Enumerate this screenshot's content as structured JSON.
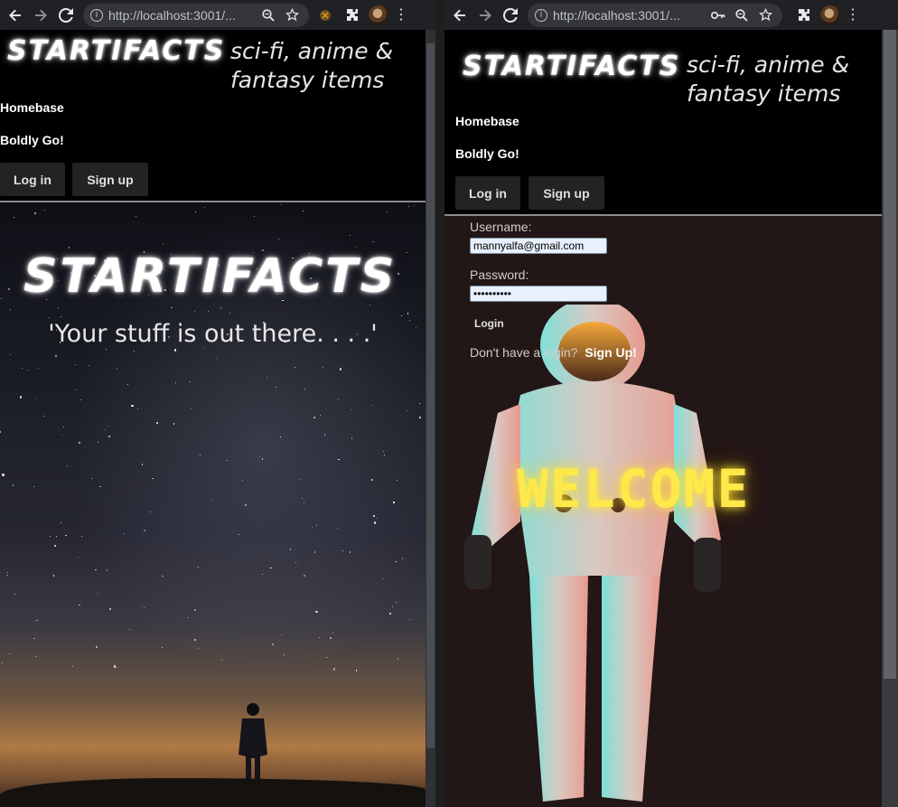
{
  "left_window": {
    "browser": {
      "url": "http://localhost:3001/...",
      "icons": [
        "back-icon",
        "forward-icon",
        "reload-icon",
        "info-icon",
        "zoom-icon",
        "star-icon",
        "extension-icon",
        "puzzle-icon",
        "profile-avatar",
        "menu-icon"
      ]
    },
    "site": {
      "logo": "STARTIFACTS",
      "tagline_line1": "sci-fi, anime &",
      "tagline_line2": "fantasy items",
      "nav": [
        "Homebase",
        "Boldly Go!"
      ],
      "login_label": "Log in",
      "signup_label": "Sign up"
    },
    "hero": {
      "logo": "STARTIFACTS",
      "quote": "'Your stuff is out there. . . .'"
    }
  },
  "right_window": {
    "browser": {
      "url": "http://localhost:3001/..."
    },
    "site": {
      "logo": "STARTIFACTS",
      "tagline_line1": "sci-fi, anime &",
      "tagline_line2": "fantasy items",
      "nav": [
        "Homebase",
        "Boldly Go!"
      ],
      "login_label": "Log in",
      "signup_label": "Sign up"
    },
    "login_form": {
      "username_label": "Username:",
      "username_value": "mannyalfa@gmail.com",
      "password_label": "Password:",
      "password_value": "••••••••••",
      "submit_label": "Login",
      "no_account_text": "Don't have a login?",
      "signup_link": "Sign Up!"
    },
    "hero": {
      "welcome_text": "WELCOME"
    }
  },
  "colors": {
    "page_bg": "#000000",
    "button_bg": "#232323",
    "login_bg": "#231616",
    "welcome_glow": "#ffe84a",
    "chrome_bg": "#202124"
  }
}
